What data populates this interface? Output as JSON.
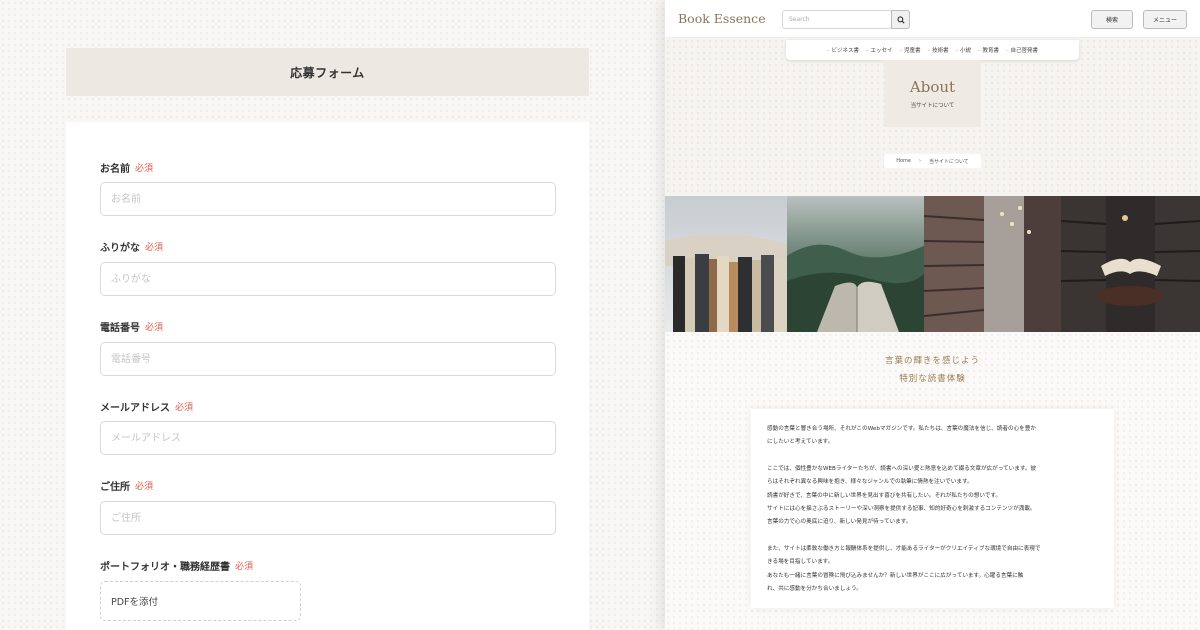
{
  "form": {
    "title": "応募フォーム",
    "required_label": "必須",
    "fields": [
      {
        "label": "お名前",
        "placeholder": "お名前"
      },
      {
        "label": "ふりがな",
        "placeholder": "ふりがな"
      },
      {
        "label": "電話番号",
        "placeholder": "電話番号"
      },
      {
        "label": "メールアドレス",
        "placeholder": "メールアドレス"
      },
      {
        "label": "ご住所",
        "placeholder": "ご住所"
      }
    ],
    "portfolio": {
      "label": "ポートフォリオ・職務経歴書",
      "attach_label": "PDFを添付"
    }
  },
  "site": {
    "logo": "Book Essence",
    "search_placeholder": "Search",
    "search_button": "検索",
    "menu_button": "メニュー",
    "nav": [
      "ビジネス書",
      "エッセイ",
      "児童書",
      "技術書",
      "小説",
      "教育書",
      "自己啓発書"
    ],
    "about": {
      "title": "About",
      "subtitle": "当サイトについて"
    },
    "breadcrumb": {
      "home": "Home",
      "separator": "›",
      "current": "当サイトについて"
    },
    "tagline": [
      "言葉の輝きを感じよう",
      "特別な読書体験"
    ],
    "paragraphs": [
      [
        "感動の言葉と響き合う場所、それがこのWebマガジンです。私たちは、言葉の魔法を信じ、読者の心を豊か",
        "にしたいと考えています。"
      ],
      [
        "ここでは、個性豊かなWEBライターたちが、読書への深い愛と熱意を込めて綴る文章が広がっています。彼",
        "らはそれぞれ異なる興味を抱き、様々なジャンルでの執筆に情熱を注いでいます。",
        "読書が好きで、言葉の中に新しい世界を見出す喜びを共有したい。それが私たちの想いです。",
        "サイトには心を揺さぶるストーリーや深い洞察を提供する記事、知的好奇心を刺激するコンテンツが満載。",
        "言葉の力で心の奥底に迫り、新しい発見が待っています。"
      ],
      [
        "また、サイトは柔軟な働き方と報酬体系を提供し、才能あるライターがクリエイティブな環境で自由に表現で",
        "きる場を目指しています。",
        "あなたも一緒に言葉の冒険に飛び込みませんか？新しい世界がここに広がっています。心躍る言葉に触",
        "れ、共に感動を分かち合いましょう。"
      ]
    ],
    "colors": {
      "accent": "#8b7355",
      "required": "#e05a4e",
      "tagline": "#9a7a4e"
    }
  }
}
